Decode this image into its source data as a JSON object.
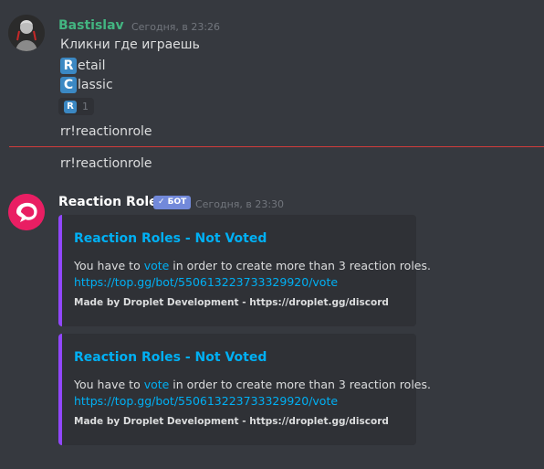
{
  "messages": {
    "user": {
      "username": "Bastislav",
      "timestamp": "Сегодня, в 23:26",
      "text": "Кликни где играешь",
      "roles": [
        {
          "emoji": "R",
          "text": "etail"
        },
        {
          "emoji": "C",
          "text": "lassic"
        }
      ],
      "reaction": {
        "emoji": "R",
        "count": "1"
      },
      "command": "rr!reactionrole"
    },
    "command2": "rr!reactionrole",
    "bot": {
      "username": "Reaction Roles",
      "badge": "✓ БОТ",
      "timestamp": "Сегодня, в 23:30",
      "embeds": [
        {
          "title": "Reaction Roles - Not Voted",
          "desc_pre": "You have to ",
          "desc_link": "vote",
          "desc_post": " in order to create more than 3 reaction roles.",
          "url": "https://top.gg/bot/550613223733329920/vote",
          "footer": "Made by Droplet Development - https://droplet.gg/discord"
        },
        {
          "title": "Reaction Roles - Not Voted",
          "desc_pre": "You have to ",
          "desc_link": "vote",
          "desc_post": " in order to create more than 3 reaction roles.",
          "url": "https://top.gg/bot/550613223733329920/vote",
          "footer": "Made by Droplet Development - https://droplet.gg/discord"
        }
      ]
    }
  },
  "colors": {
    "background": "#36393f",
    "user_name": "#43b581",
    "link": "#00b0f4",
    "embed_accent": "#9147ff",
    "bot_tag": "#7289da",
    "new_messages_divider": "#d13c3c"
  }
}
